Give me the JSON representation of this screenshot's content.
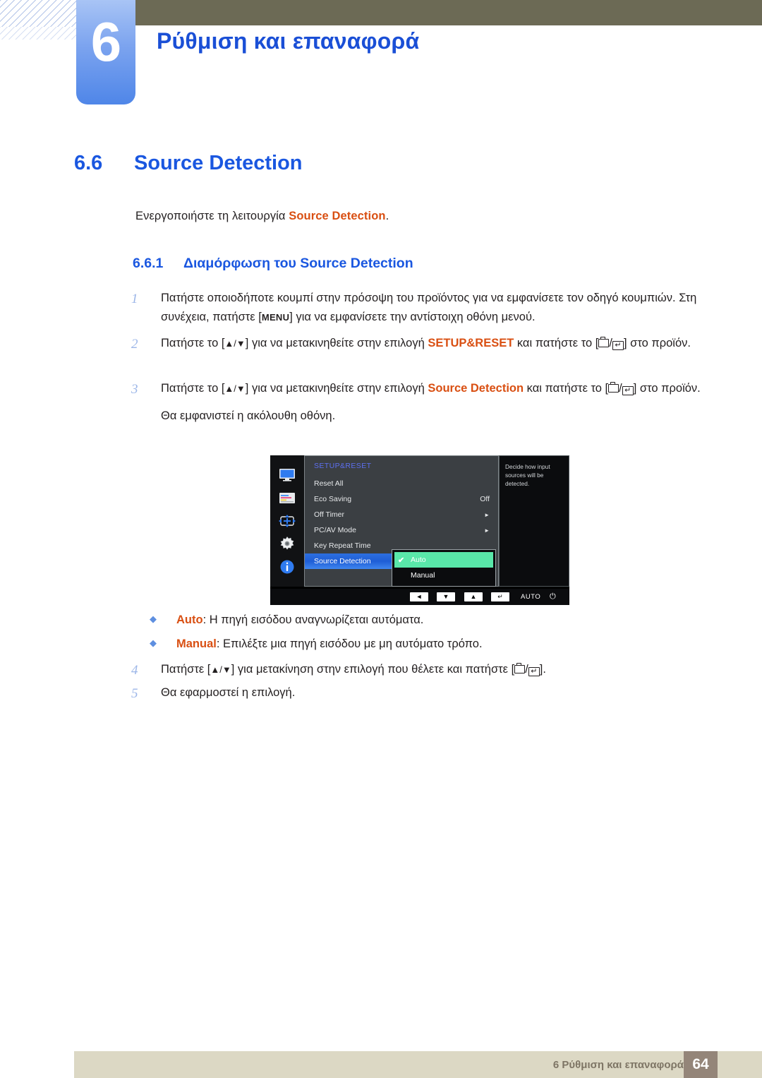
{
  "header": {
    "chapter_number": "6",
    "chapter_title": "Ρύθμιση και επαναφορά"
  },
  "section": {
    "number": "6.6",
    "title": "Source Detection",
    "intro_prefix": "Ενεργοποιήστε τη λειτουργία ",
    "intro_emphasis": "Source Detection",
    "intro_suffix": "."
  },
  "subsection": {
    "number": "6.6.1",
    "title": "Διαμόρφωση του Source Detection"
  },
  "steps": [
    {
      "marker": "1",
      "text_a": "Πατήστε οποιοδήποτε κουμπί στην πρόσοψη του προϊόντος για να εμφανίσετε τον οδηγό κουμπιών. Στη συνέχεια, πατήστε [",
      "key": "MENU",
      "text_b": "] για να εμφανίσετε την αντίστοιχη οθόνη μενού."
    },
    {
      "marker": "2",
      "text_a": "Πατήστε το [",
      "keys": "▲/▼",
      "text_b": "] για να μετακινηθείτε στην επιλογή ",
      "emphasis": "SETUP&RESET",
      "text_c": " και πατήστε το [",
      "text_d": "] στο προϊόν."
    },
    {
      "marker": "3",
      "text_a": "Πατήστε το [",
      "keys": "▲/▼",
      "text_b": "] για να μετακινηθείτε στην επιλογή ",
      "emphasis": "Source Detection",
      "text_c": " και πατήστε το [",
      "text_d": "] στο προϊόν.",
      "note": "Θα εμφανιστεί η ακόλουθη οθόνη."
    },
    {
      "marker": "4",
      "text_a": "Πατήστε [",
      "keys": "▲/▼",
      "text_b": "] για μετακίνηση στην επιλογή που θέλετε και πατήστε [",
      "text_d": "]."
    },
    {
      "marker": "5",
      "text_a": "Θα εφαρμοστεί η επιλογή."
    }
  ],
  "osd": {
    "menu_title": "SETUP&RESET",
    "rows": [
      {
        "label": "Reset All",
        "value": "",
        "arrow": ""
      },
      {
        "label": "Eco Saving",
        "value": "Off",
        "arrow": ""
      },
      {
        "label": "Off Timer",
        "value": "",
        "arrow": "►"
      },
      {
        "label": "PC/AV Mode",
        "value": "",
        "arrow": "►"
      },
      {
        "label": "Key Repeat Time",
        "value": "",
        "arrow": ""
      },
      {
        "label": "Source Detection",
        "value": "",
        "arrow": "",
        "selected": true
      }
    ],
    "submenu": [
      {
        "label": "Auto",
        "checked": true
      },
      {
        "label": "Manual",
        "checked": false
      }
    ],
    "help_text": "Decide how input sources will be detected.",
    "button_bar": {
      "left_arrow": "◄",
      "down_arrow": "▼",
      "up_arrow": "▲",
      "enter": "↵",
      "auto_label": "AUTO",
      "power": "⏻"
    },
    "sidebar_icons": [
      "display-icon",
      "color-bars-icon",
      "position-arrows-icon",
      "gear-icon",
      "info-icon"
    ],
    "colors": {
      "highlight_blue": "#2d6fe0",
      "highlight_green": "#59e7a9",
      "title_blue": "#5d6ff0"
    }
  },
  "bullets": [
    {
      "term": "Auto",
      "text": ": Η πηγή εισόδου αναγνωρίζεται αυτόματα."
    },
    {
      "term": "Manual",
      "text": ": Επιλέξτε μια πηγή εισόδου με μη αυτόματο τρόπο."
    }
  ],
  "footer": {
    "text": "6 Ρύθμιση και επαναφορά",
    "page": "64"
  }
}
